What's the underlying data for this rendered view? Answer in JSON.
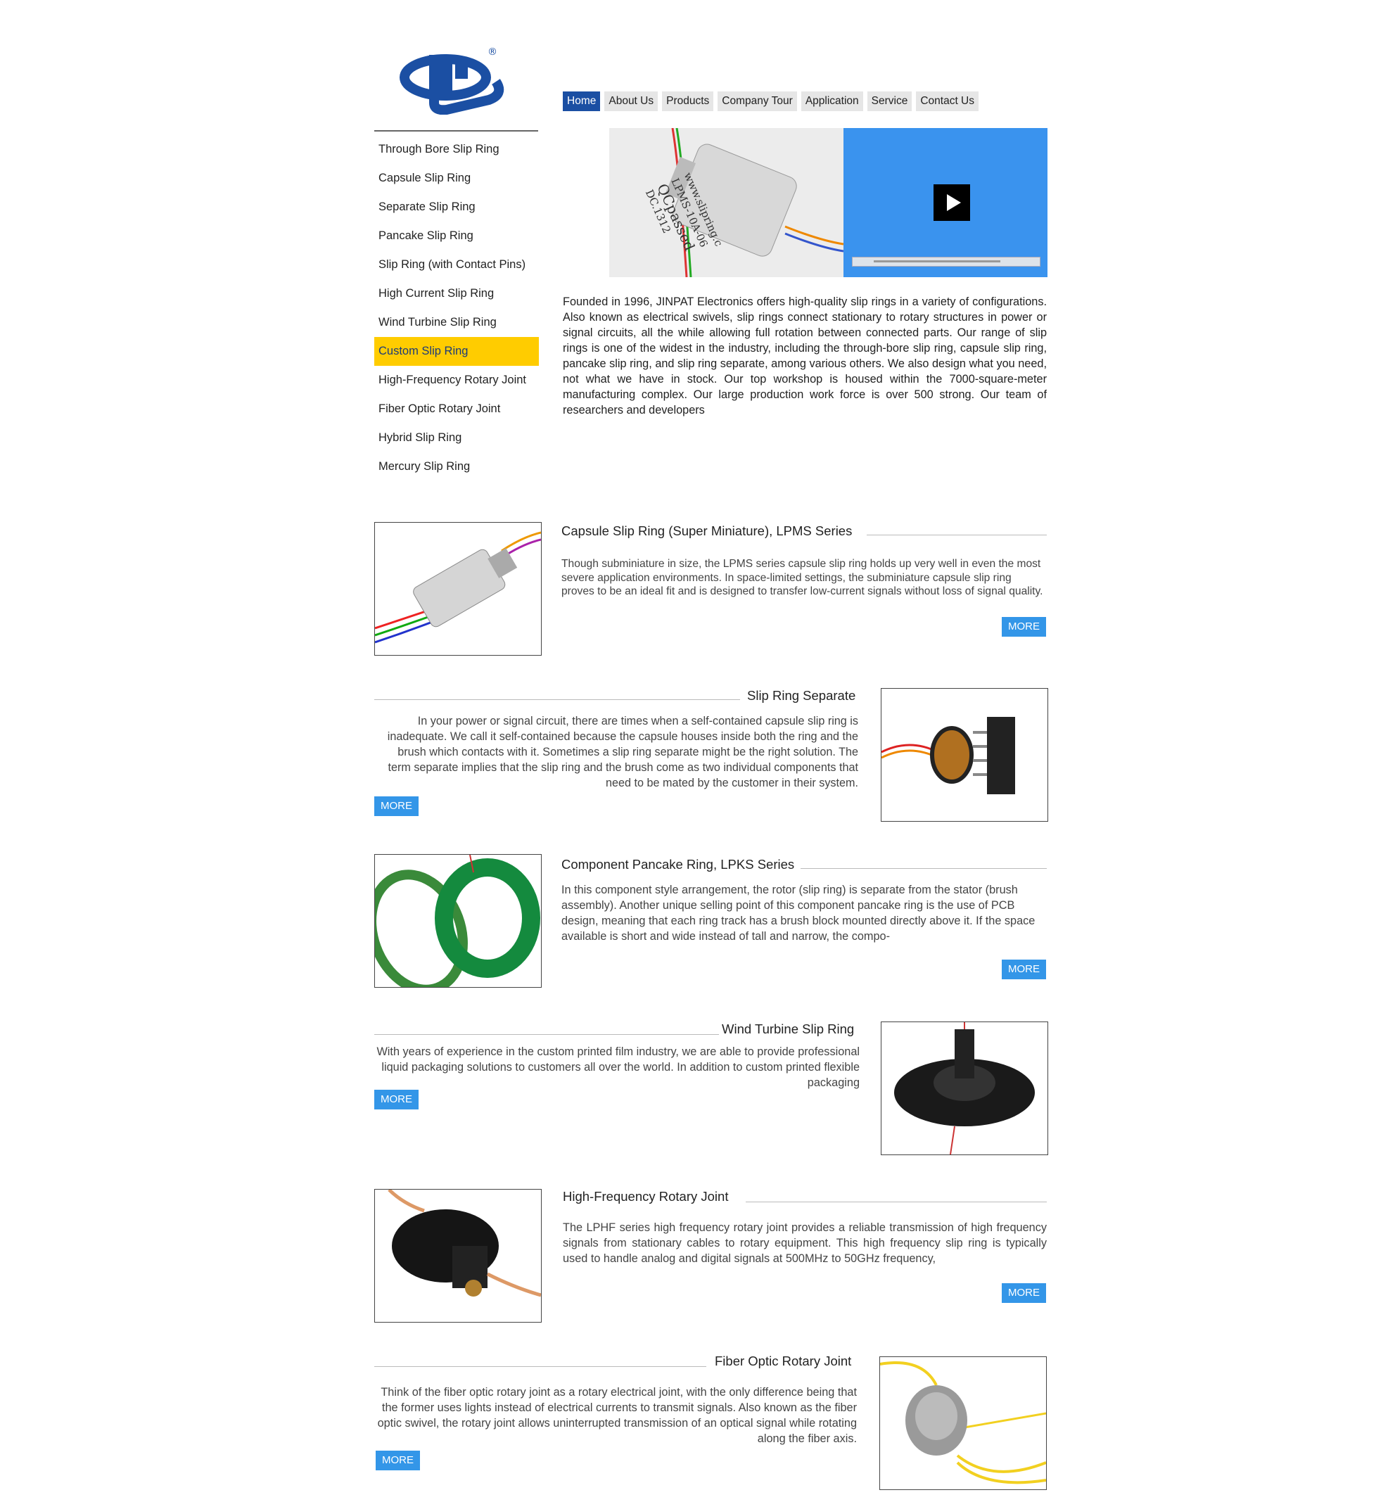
{
  "brand": {
    "logo_name": "JP logo",
    "registered_mark": "®"
  },
  "nav": {
    "items": [
      "Home",
      "About Us",
      "Products",
      "Company Tour",
      "Application",
      "Service",
      "Contact Us"
    ],
    "active": "Home"
  },
  "sidebar": {
    "items": [
      "Through Bore Slip Ring",
      "Capsule Slip Ring",
      "Separate Slip Ring",
      "Pancake Slip Ring",
      "Slip Ring (with Contact Pins)",
      "High Current Slip Ring",
      "Wind Turbine Slip Ring",
      "Custom Slip Ring",
      "High-Frequency Rotary Joint",
      "Fiber Optic Rotary Joint",
      "Hybrid Slip Ring",
      "Mercury Slip Ring"
    ],
    "active": "Custom Slip Ring"
  },
  "hero": {
    "image_text": [
      "www.slipring.c",
      "LPMS-10A-06",
      "QCpassed",
      "DC.1312"
    ]
  },
  "intro": {
    "text": "Founded in 1996, JINPAT Electronics offers high-quality slip rings in a variety of configurations. Also known as electrical swivels, slip rings connect stationary to rotary structures in power or signal circuits, all the while allowing full rotation between connected parts. Our range of slip rings is one of the widest in the industry, including the through-bore slip ring, capsule slip ring, pancake slip ring, and slip ring separate, among various others. We also design what you need, not what we have in stock. Our top workshop is housed within the 7000-square-meter manufacturing complex. Our large production work force is over 500 strong. Our team of researchers and developers"
  },
  "products": [
    {
      "title": "Capsule Slip Ring (Super Miniature), LPMS Series",
      "desc": "Though subminiature in size, the LPMS series capsule slip ring holds up very well in even the most severe application environments. In space-limited settings, the subminiature capsule slip ring proves to be an ideal fit and is designed to transfer low-current signals without loss of signal quality.",
      "more": "MORE"
    },
    {
      "title": "Slip Ring Separate",
      "desc": "In your power or signal circuit, there are times when a self-contained capsule slip ring is inadequate. We call it self-contained because the capsule houses inside both the ring and the brush which contacts with it. Sometimes a slip ring separate might be the right solution. The term separate implies that the slip ring and the brush come as two individual components that need to be mated by the customer in their system.",
      "more": "MORE"
    },
    {
      "title": "Component Pancake Ring, LPKS Series",
      "desc": "In this component style arrangement, the rotor (slip ring) is separate from the stator (brush assembly). Another unique selling point of this component pancake ring is the use of PCB design, meaning that each ring track has a brush block mounted directly above it. If the space available is short and wide instead of tall and narrow, the compo-",
      "more": "MORE"
    },
    {
      "title": "Wind Turbine Slip Ring",
      "desc": "With years of experience in the custom printed film industry, we are able to provide professional liquid packaging solutions to customers all over the world. In addition to custom printed flexible packaging",
      "more": "MORE"
    },
    {
      "title": "High-Frequency Rotary Joint",
      "desc": "The LPHF series high frequency rotary joint provides a reliable transmission of high frequency signals from stationary cables to rotary equipment. This high frequency slip ring is typically used to handle analog and digital signals at 500MHz to 50GHz frequency,",
      "more": "MORE"
    },
    {
      "title": "Fiber Optic Rotary Joint",
      "desc": "Think of the fiber optic rotary joint as a rotary electrical joint, with the only difference being that the former uses lights instead of electrical currents to transmit signals. Also known as the fiber optic swivel, the rotary joint allows uninterrupted transmission of an optical signal while rotating along the fiber axis.",
      "more": "MORE"
    }
  ],
  "colors": {
    "nav_active": "#1b4fa3",
    "sidebar_active": "#ffcc00",
    "more_button": "#3396e8",
    "video_bg": "#3a93ee"
  }
}
